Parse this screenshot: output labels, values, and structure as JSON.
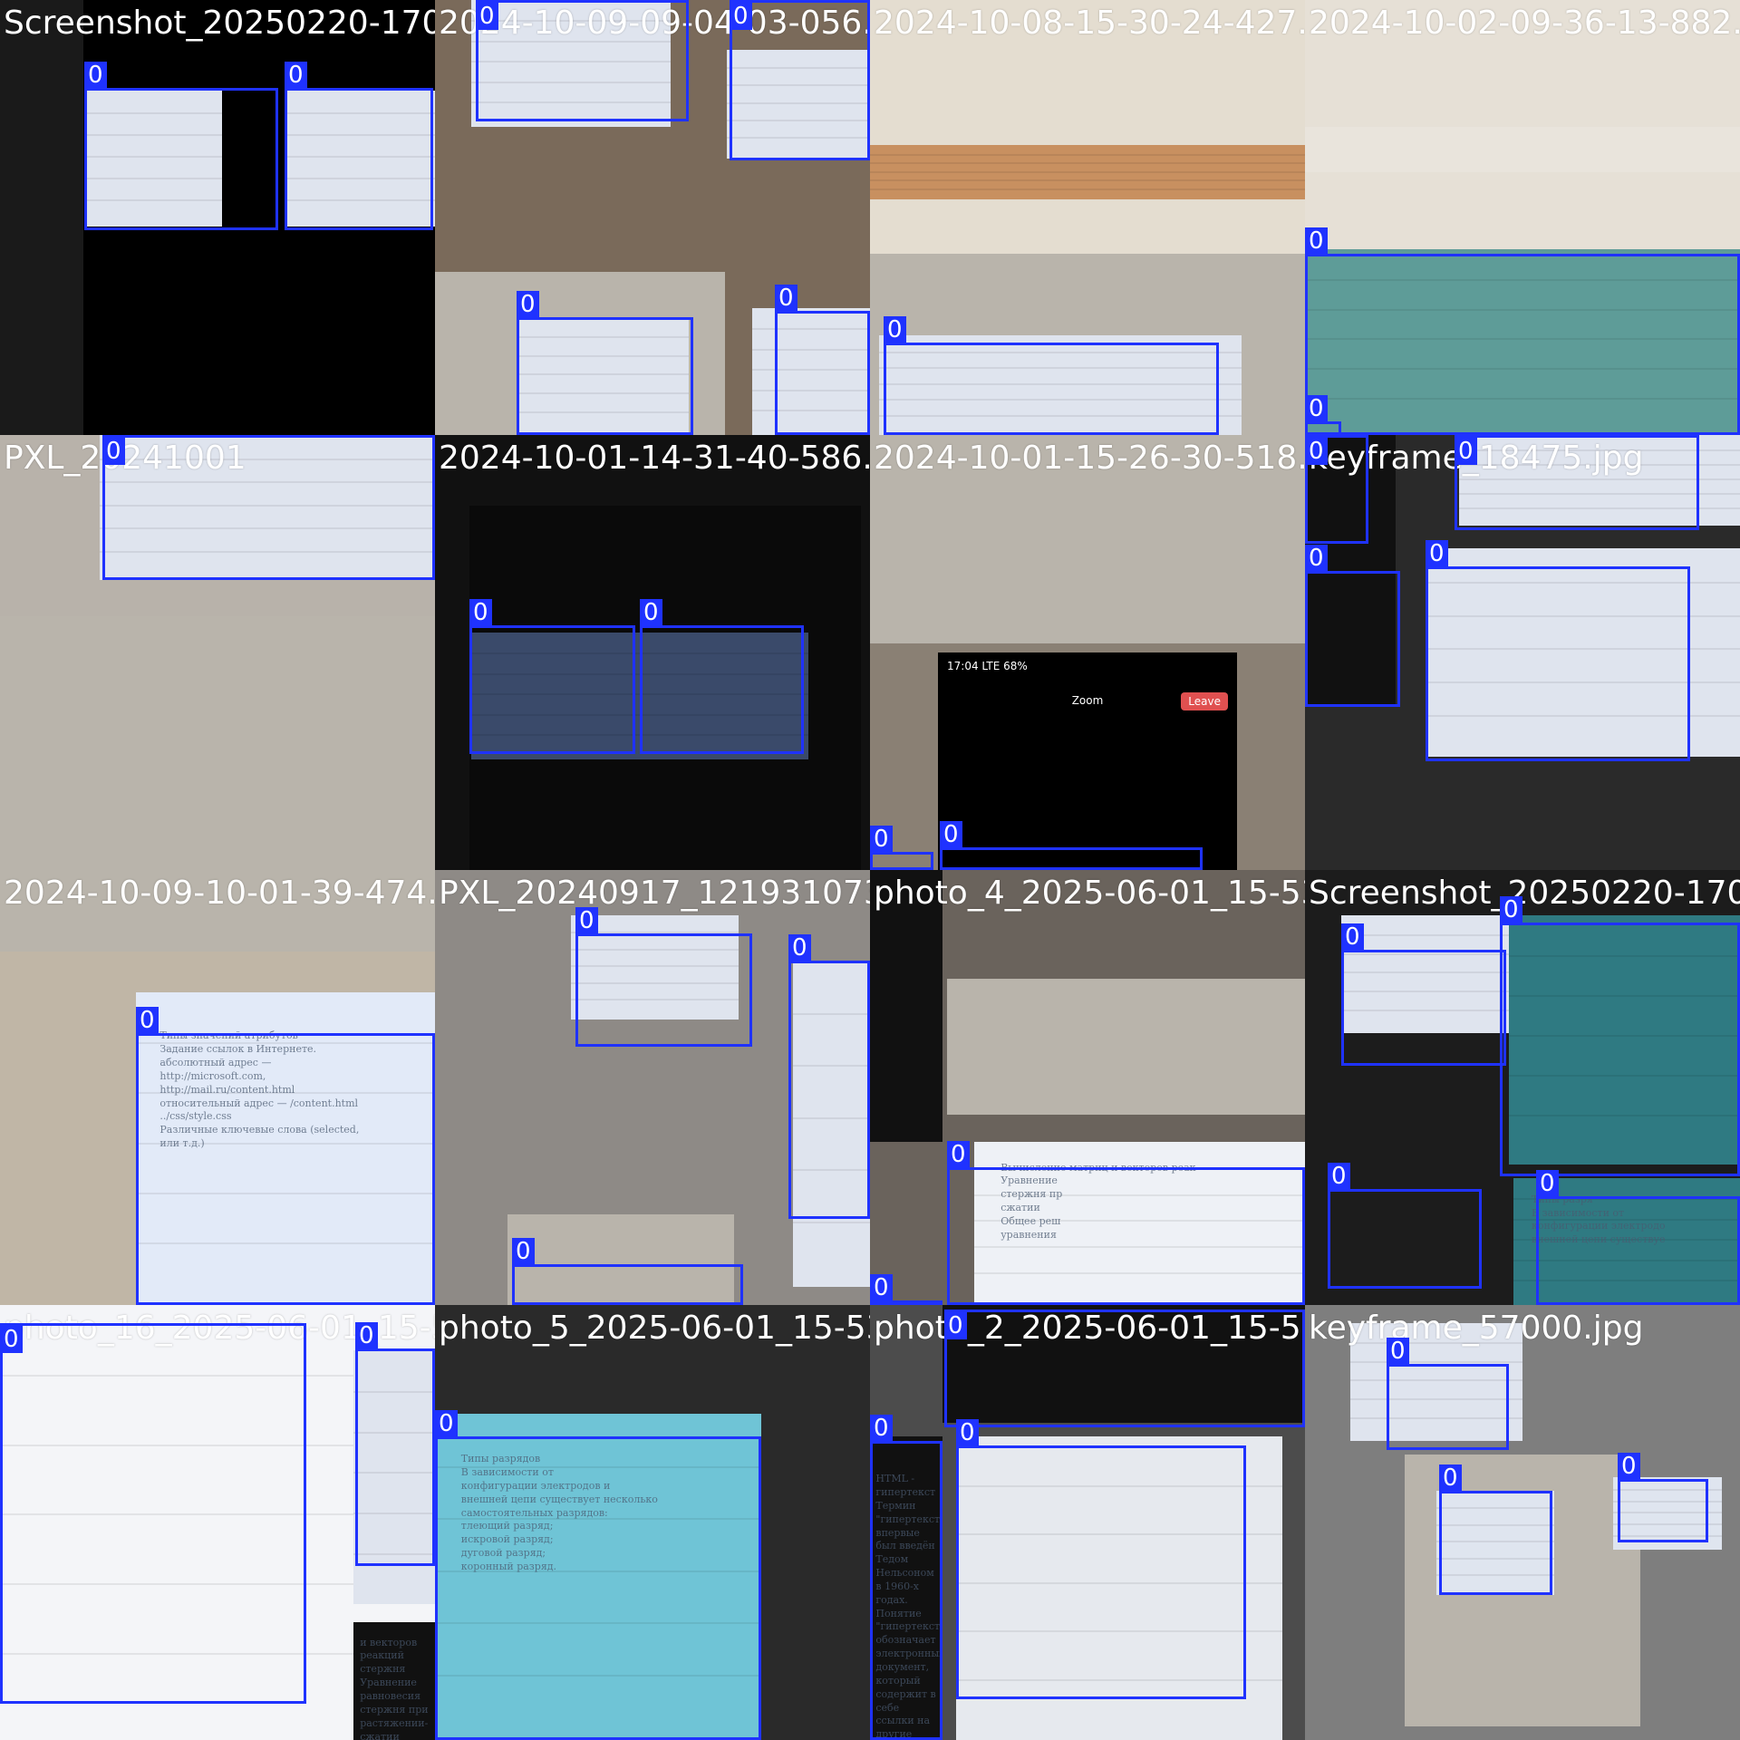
{
  "mosaic": {
    "box_color": "#1f32ff",
    "tiles": [
      {
        "filename": "Screenshot_20250220-170426_Zoom.png",
        "boxes": [
          {
            "label": "0"
          },
          {
            "label": "0"
          }
        ],
        "colors": {
          "bg": "#1a1a1a",
          "accent": "#000000"
        }
      },
      {
        "filename": "2024-10-09-09-04-03-056.jpg",
        "boxes": [
          {
            "label": "0"
          },
          {
            "label": "0"
          },
          {
            "label": "0"
          },
          {
            "label": "0"
          }
        ],
        "colors": {
          "bg": "#7a6a5a",
          "accent": "#d8dde8"
        }
      },
      {
        "filename": "2024-10-08-15-30-24-427.jpg",
        "boxes": [
          {
            "label": "0"
          }
        ],
        "colors": {
          "bg": "#e4ddd0",
          "accent": "#c89060"
        }
      },
      {
        "filename": "2024-10-02-09-36-13-882.jpg",
        "boxes": [
          {
            "label": "0"
          },
          {
            "label": "0"
          }
        ],
        "colors": {
          "bg": "#e6e0d6",
          "accent": "#5e9c98"
        }
      },
      {
        "filename": "PXL_20241001",
        "boxes": [
          {
            "label": "0"
          }
        ],
        "colors": {
          "bg": "#b8b2aa",
          "accent": "#dfe6f4"
        }
      },
      {
        "filename": "2024-10-01-14-31-40-586.jpg",
        "boxes": [
          {
            "label": "0"
          },
          {
            "label": "0"
          }
        ],
        "colors": {
          "bg": "#0a0a0a",
          "accent": "#3a4a6a"
        }
      },
      {
        "filename": "2024-10-01-15-26-30-518.jpg",
        "boxes": [
          {
            "label": "0"
          },
          {
            "label": "0"
          }
        ],
        "colors": {
          "bg": "#8a8074",
          "accent": "#000000"
        },
        "phone": {
          "time": "17:04",
          "status": "LTE 68%",
          "zoom": "Zoom",
          "leave": "Leave"
        }
      },
      {
        "filename": "keyframe_18475.jpg",
        "boxes": [
          {
            "label": "0"
          },
          {
            "label": "0"
          },
          {
            "label": "0"
          },
          {
            "label": "0"
          }
        ],
        "colors": {
          "bg": "#2a2a2a",
          "accent": "#d2dcee"
        }
      },
      {
        "filename": "2024-10-09-10-01-39-474.jpg",
        "boxes": [
          {
            "label": "0"
          }
        ],
        "colors": {
          "bg": "#c0b6a6",
          "accent": "#e2eaf8"
        },
        "slide_text": "Типы значений атрибутов\nЗадание ссылок в Интернете.\nабсолютный адрес —\nhttp://microsoft.com,\nhttp://mail.ru/content.html\nотносительный адрес — /content.html\n../css/style.css\nРазличные ключевые слова (selected,\nили т.д.)"
      },
      {
        "filename": "PXL_20240917_121931073.jpg",
        "boxes": [
          {
            "label": "0"
          },
          {
            "label": "0"
          },
          {
            "label": "0"
          }
        ],
        "colors": {
          "bg": "#8e8a86",
          "accent": "#e8edf4"
        }
      },
      {
        "filename": "photo_4_2025-06-01_15-53-54.jpg",
        "boxes": [
          {
            "label": "0"
          },
          {
            "label": "0"
          }
        ],
        "colors": {
          "bg": "#6a635c",
          "accent": "#eef1f6"
        },
        "slide_text": "Вычисление матриц и векторов реак\nУравнение\nстержня пр\nсжатии\nОбщее реш\nуравнения"
      },
      {
        "filename": "Screenshot_20250220-170036_Zoom.png",
        "boxes": [
          {
            "label": "0"
          },
          {
            "label": "0"
          },
          {
            "label": "0"
          },
          {
            "label": "0"
          }
        ],
        "colors": {
          "bg": "#1c1c1c",
          "accent": "#2f7a82"
        },
        "slide_text": "Типы разря\nВ зависимости от\nконфигурации электродо\nвнешней цепи существуе"
      },
      {
        "filename": "photo_16_2025-06-01_15-53-54.jpg",
        "boxes": [
          {
            "label": "0"
          },
          {
            "label": "0"
          }
        ],
        "colors": {
          "bg": "#d9dce4",
          "accent": "#f4f5f8"
        },
        "slide_text": "и векторов реакций стержня\nУравнение равновесия\nстержня при растяжении-\nсжатии\nОбщее решение этого\nуравнения\nГраничные условия"
      },
      {
        "filename": "photo_5_2025-06-01_15-53-54.jpg",
        "boxes": [
          {
            "label": "0"
          }
        ],
        "colors": {
          "bg": "#2a2a2a",
          "accent": "#6fc4d6"
        },
        "slide_text": "Типы разрядов\nВ зависимости от\nконфигурации электродов и\nвнешней цепи существует несколько\nсамостоятельных разрядов:\nтлеющий разряд;\nискровой разряд;\nдуговой разряд;\nкоронный разряд."
      },
      {
        "filename": "photo_2_2025-06-01_15-53-54.jpg",
        "boxes": [
          {
            "label": "0"
          },
          {
            "label": "0"
          },
          {
            "label": "0"
          }
        ],
        "colors": {
          "bg": "#4c4c4c",
          "accent": "#e6e9ee"
        },
        "slide_text": "HTML - гипертекст\nТермин \"гипертекст\" впервые был введён Тедом\nНельсоном в 1960-х годах. Понятие \"гипертекст\"\nобозначает электронный документ, который\nсодержит в себе ссылки на другие документы."
      },
      {
        "filename": "keyframe_57000.jpg",
        "boxes": [
          {
            "label": "0"
          },
          {
            "label": "0"
          },
          {
            "label": "0"
          }
        ],
        "colors": {
          "bg": "#7e7e7e",
          "accent": "#dfe5ef"
        }
      }
    ]
  }
}
